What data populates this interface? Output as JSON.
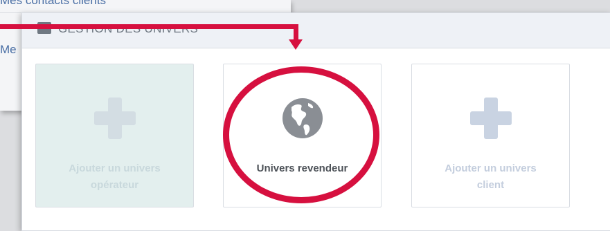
{
  "background": {
    "menu_items": [
      "Mes contacts clients",
      "Me"
    ]
  },
  "panel": {
    "header_title": "GESTION DES UNIVERS",
    "header_icon": "folder-icon"
  },
  "cards": [
    {
      "label_line1": "Ajouter un univers",
      "label_line2": "opérateur",
      "icon": "plus-icon",
      "state": "disabled"
    },
    {
      "label_line1": "Univers revendeur",
      "label_line2": "",
      "icon": "globe-icon",
      "state": "active"
    },
    {
      "label_line1": "Ajouter un univers",
      "label_line2": "client",
      "icon": "plus-icon",
      "state": "enabled"
    }
  ],
  "colors": {
    "annotation": "#d6103f",
    "disabled_card": "#e3efee",
    "disabled_text": "#c8d8dc",
    "enabled_plus": "#c9d3e2",
    "enabled_text": "#c3cddd",
    "active_text": "#4d5258",
    "globe": "#8a8e94"
  }
}
